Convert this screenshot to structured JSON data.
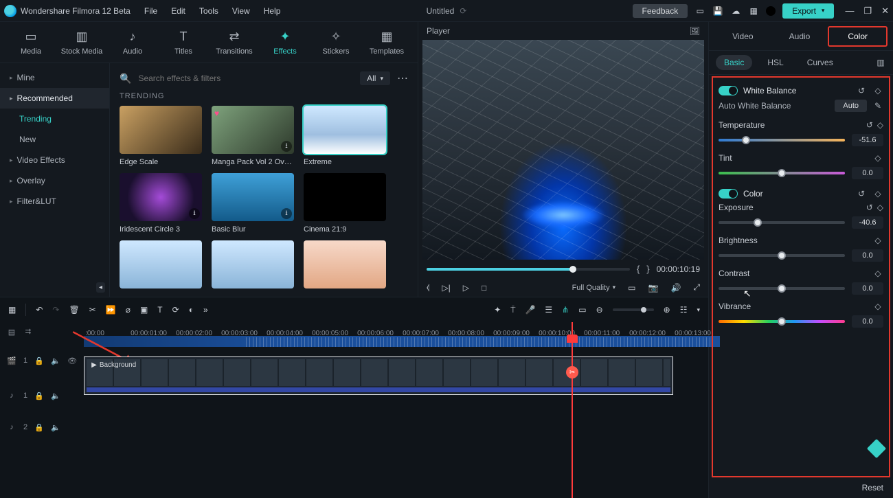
{
  "title": {
    "app": "Wondershare Filmora 12 Beta",
    "doc": "Untitled"
  },
  "menu": [
    "File",
    "Edit",
    "Tools",
    "View",
    "Help"
  ],
  "titlebar": {
    "feedback": "Feedback",
    "export": "Export"
  },
  "mediaTabs": [
    {
      "label": "Media",
      "icon": "▭"
    },
    {
      "label": "Stock Media",
      "icon": "▥"
    },
    {
      "label": "Audio",
      "icon": "♪"
    },
    {
      "label": "Titles",
      "icon": "T"
    },
    {
      "label": "Transitions",
      "icon": "⇄"
    },
    {
      "label": "Effects",
      "icon": "✦",
      "active": true
    },
    {
      "label": "Stickers",
      "icon": "✧"
    },
    {
      "label": "Templates",
      "icon": "▦"
    }
  ],
  "sidebar": {
    "items": [
      {
        "label": "Mine",
        "chev": true
      },
      {
        "label": "Recommended",
        "chev": true,
        "recommended": true
      },
      {
        "label": "Trending",
        "sub": true,
        "active": true
      },
      {
        "label": "New",
        "sub": true
      },
      {
        "label": "Video Effects",
        "chev": true
      },
      {
        "label": "Overlay",
        "chev": true
      },
      {
        "label": "Filter&LUT",
        "chev": true
      }
    ]
  },
  "search": {
    "placeholder": "Search effects & filters",
    "all": "All"
  },
  "effects": {
    "section": "TRENDING",
    "row1": [
      {
        "label": "Edge Scale",
        "bg": "linear-gradient(135deg,#c9a062,#3a2c1a)"
      },
      {
        "label": "Manga Pack Vol 2 Ove...",
        "heart": true,
        "dl": true,
        "bg": "linear-gradient(135deg,#7ea27c,#2e3a2c)"
      },
      {
        "label": "Extreme",
        "selected": true,
        "bg": "linear-gradient(180deg,#cfe8ff,#9fbfe0 60%,#ffffff 100%)"
      }
    ],
    "row2": [
      {
        "label": "Iridescent Circle 3",
        "dl": true,
        "bg": "radial-gradient(circle,#a44bd8 0%,#1a0f2e 70%)"
      },
      {
        "label": "Basic Blur",
        "dl": true,
        "bg": "linear-gradient(180deg,#3fa0d8,#135b8a)"
      },
      {
        "label": "Cinema 21:9",
        "bg": "#000"
      }
    ],
    "row3": [
      {
        "bg": "linear-gradient(180deg,#cfe8ff,#8ab4d8)"
      },
      {
        "bg": "linear-gradient(180deg,#cfe8ff,#8ab4d8)"
      },
      {
        "bg": "linear-gradient(180deg,#f7d9c9,#e2a784)"
      }
    ]
  },
  "player": {
    "title": "Player",
    "timecode": "00:00:10:19",
    "quality": "Full Quality"
  },
  "timeline": {
    "ruler": [
      " :00:00",
      "00:00:01:00",
      "00:00:02:00",
      "00:00:03:00",
      "00:00:04:00",
      "00:00:05:00",
      "00:00:06:00",
      "00:00:07:00",
      "00:00:08:00",
      "00:00:09:00",
      "00:00:10:00",
      "00:00:11:00",
      "00:00:12:00",
      "00:00:13:00"
    ],
    "clip": "Background",
    "tracks": {
      "video": "1",
      "audio1": "1",
      "audio2": "2"
    }
  },
  "right": {
    "tabs": [
      "Video",
      "Audio",
      "Color"
    ],
    "subtabs": [
      "Basic",
      "HSL",
      "Curves"
    ],
    "whiteBalance": "White Balance",
    "awb": "Auto White Balance",
    "auto": "Auto",
    "temperature": {
      "label": "Temperature",
      "value": "-51.6",
      "pos": 22
    },
    "tint": {
      "label": "Tint",
      "value": "0.0",
      "pos": 50
    },
    "colorSection": "Color",
    "exposure": {
      "label": "Exposure",
      "value": "-40.6",
      "pos": 31
    },
    "brightness": {
      "label": "Brightness",
      "value": "0.0",
      "pos": 50
    },
    "contrast": {
      "label": "Contrast",
      "value": "0.0",
      "pos": 50
    },
    "vibrance": {
      "label": "Vibrance",
      "value": "0.0",
      "pos": 50
    },
    "reset": "Reset"
  }
}
